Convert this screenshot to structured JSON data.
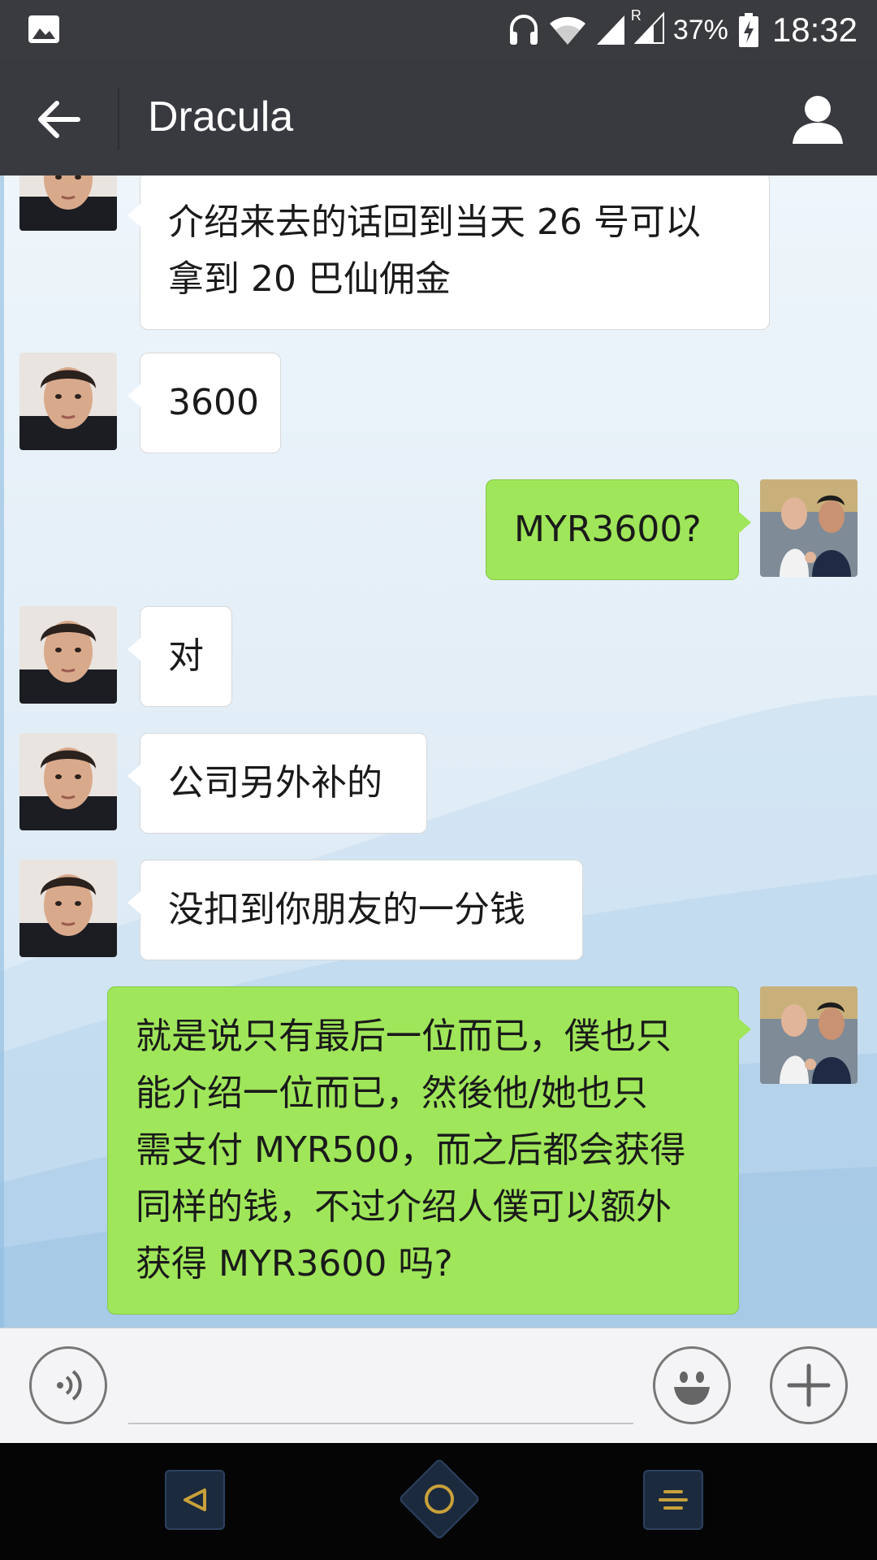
{
  "status_bar": {
    "icons": [
      "gallery-icon",
      "headset-icon",
      "wifi-icon",
      "signal-icon",
      "signal-roaming-icon",
      "battery-charging-icon"
    ],
    "roaming_label": "R",
    "battery_percent": "37%",
    "time": "18:32"
  },
  "header": {
    "title": "Dracula",
    "back_icon": "arrow-left-icon",
    "profile_icon": "person-icon"
  },
  "colors": {
    "header_bg": "#393a3f",
    "incoming_bubble": "#ffffff",
    "outgoing_bubble": "#9fe65a",
    "nav_accent": "#c9a13a"
  },
  "messages": [
    {
      "side": "in",
      "lines": [
        "介绍来去的话回到当天 26 号可以",
        "拿到 20 巴仙佣金"
      ]
    },
    {
      "side": "in",
      "lines": [
        "3600"
      ]
    },
    {
      "side": "out",
      "lines": [
        "MYR3600?"
      ]
    },
    {
      "side": "in",
      "lines": [
        "对"
      ]
    },
    {
      "side": "in",
      "lines": [
        "公司另外补的"
      ]
    },
    {
      "side": "in",
      "lines": [
        "没扣到你朋友的一分钱"
      ]
    },
    {
      "side": "out",
      "lines": [
        "就是说只有最后一位而已，僕也只",
        "能介绍一位而已，然後他/她也只",
        "需支付 MYR500，而之后都会获得",
        "同样的钱，不过介绍人僕可以额外",
        "获得 MYR3600 吗?"
      ]
    }
  ],
  "input_bar": {
    "voice_icon": "voice-icon",
    "emoji_icon": "smiley-icon",
    "more_icon": "plus-icon",
    "text_value": ""
  },
  "nav_bar": {
    "back_icon": "nav-back-icon",
    "home_icon": "nav-home-icon",
    "menu_icon": "nav-menu-icon"
  }
}
